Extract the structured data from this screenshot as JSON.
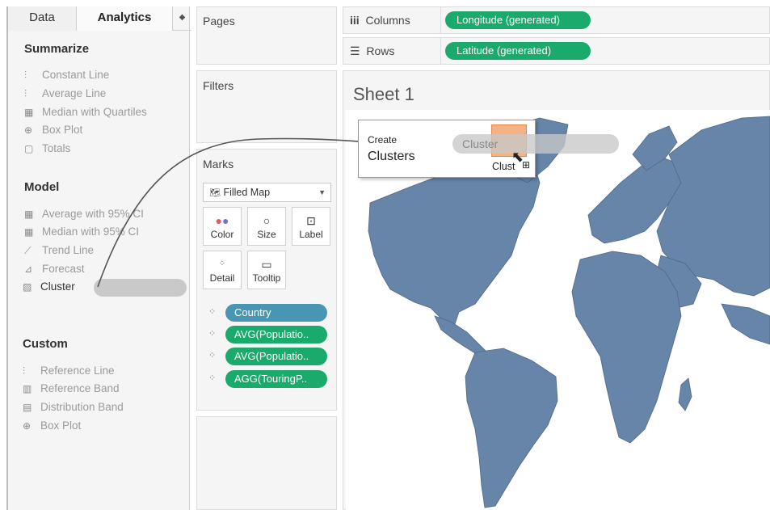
{
  "left_pane": {
    "tabs": [
      "Data",
      "Analytics"
    ],
    "summarize": {
      "title": "Summarize",
      "items": [
        "Constant Line",
        "Average Line",
        "Median with Quartiles",
        "Box Plot",
        "Totals"
      ]
    },
    "model": {
      "title": "Model",
      "items": [
        "Average with 95% CI",
        "Median with 95% CI",
        "Trend Line",
        "Forecast",
        "Cluster"
      ]
    },
    "custom": {
      "title": "Custom",
      "items": [
        "Reference Line",
        "Reference Band",
        "Distribution Band",
        "Box Plot"
      ]
    }
  },
  "middle": {
    "pages_title": "Pages",
    "filters_title": "Filters",
    "marks": {
      "title": "Marks",
      "type": "Filled Map",
      "buttons": [
        "Color",
        "Size",
        "Label",
        "Detail",
        "Tooltip"
      ],
      "pills": [
        "Country",
        "AVG(Populatio..",
        "AVG(Populatio..",
        "AGG(TouringP.."
      ]
    }
  },
  "shelves": {
    "columns_label": "Columns",
    "columns_pill": "Longitude (generated)",
    "rows_label": "Rows",
    "rows_pill": "Latitude (generated)"
  },
  "view": {
    "sheet_title": "Sheet 1",
    "popup_create": "Create",
    "popup_clusters": "Clusters",
    "drag_label": "Cluster",
    "cursor_label": "Clust"
  },
  "colors": {
    "map_fill": "#6685a9",
    "pill_green": "#1aaa6b",
    "pill_blue": "#4996b2",
    "drop_target": "#f4b183"
  }
}
